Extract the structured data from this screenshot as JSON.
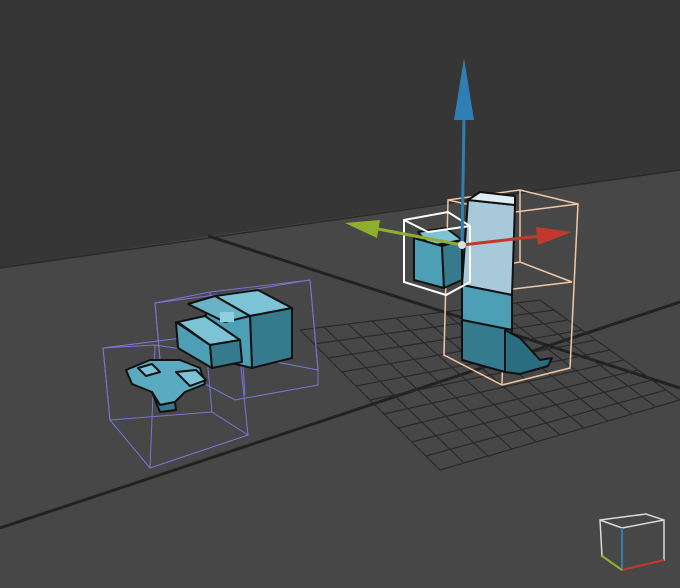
{
  "viewport": {
    "background_color": "#3b3b3b",
    "wall_color": "#353535",
    "floor_color": "#474747",
    "grid_color": "#2a2a2a",
    "floor_line_color": "#1f1f1f"
  },
  "gizmo": {
    "y_axis_color": "#2f7fb5",
    "x_axis_color": "#c03a2b",
    "z_axis_color": "#8fae2e"
  },
  "selection": {
    "selected_box_color": "#f0c7a6",
    "active_box_color": "#ffffff",
    "group_box_color": "#7b75d6"
  },
  "objects": {
    "fill_color": "#4d9fb5",
    "shade_color": "#357a8d",
    "light_color": "#7cc3d6",
    "outline_color": "#111111"
  },
  "view_cube": {
    "icon": "view-cube-icon",
    "frame_color": "#d9d9d9",
    "x_color": "#c03a2b",
    "y_color": "#2f7fb5",
    "z_color": "#8fae2e"
  }
}
